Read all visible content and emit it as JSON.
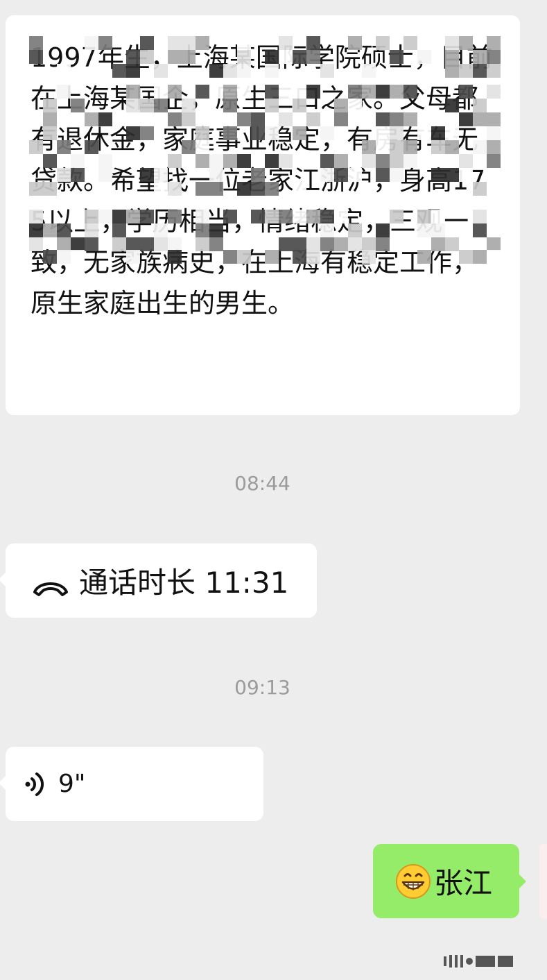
{
  "messages": {
    "profile_text": "1997年生，上海某国际学院硕士，目前在上海某国企，原生三口之家。父母都有退休金，家庭事业稳定，有房有车无贷款。希望找一位老家江浙沪，身高175以上，学历相当，情绪稳定，三观一致，无家族病史，在上海有稳定工作，原生家庭出生的男生。",
    "time1": "08:44",
    "call_label": "通话时长 11:31",
    "time2": "09:13",
    "voice_duration": "9\"",
    "sent_text": "张江"
  },
  "icons": {
    "call": "phone-handset-icon",
    "voice": "voice-waves-icon",
    "emoji": "grinning-face-icon"
  },
  "colors": {
    "background": "#ededed",
    "received_bubble": "#ffffff",
    "sent_bubble": "#95ec69",
    "timestamp": "#9b9b9b"
  }
}
